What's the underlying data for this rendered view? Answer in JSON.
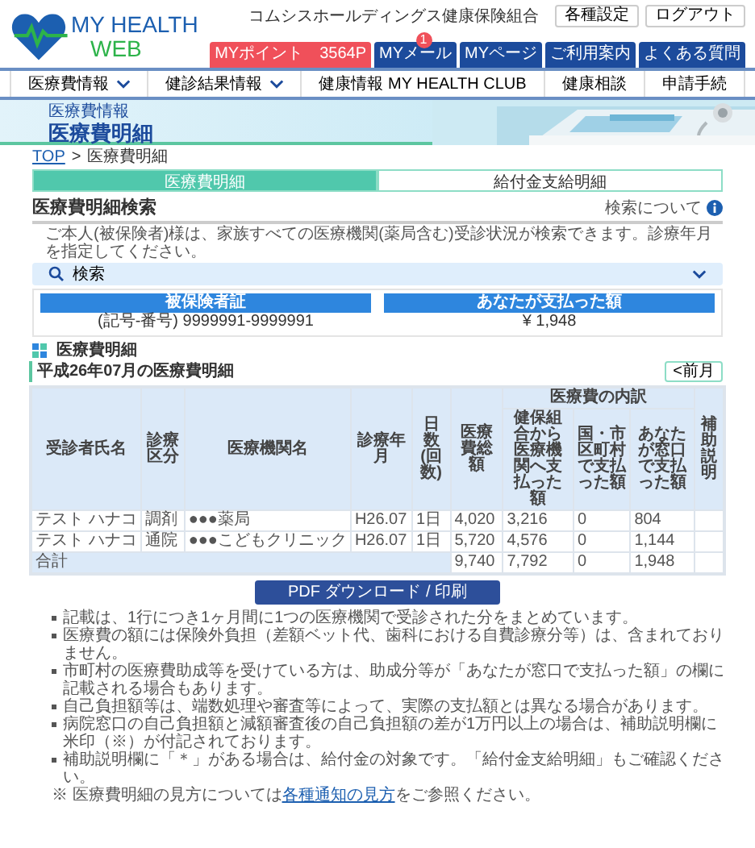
{
  "header": {
    "logo_title": "MY HEALTH",
    "logo_subtitle": "WEB",
    "org_name": "コムシスホールディングス健康保険組合",
    "buttons": [
      "各種設定",
      "ログアウト"
    ],
    "quick_links": [
      {
        "label": "MYポイント　3564P",
        "color": "#f0505a"
      },
      {
        "label": "MYメール",
        "color": "#1c4b9c",
        "badge": "1"
      },
      {
        "label": "MYページ",
        "color": "#1c4b9c"
      },
      {
        "label": "ご利用案内",
        "color": "#1c4b9c"
      },
      {
        "label": "よくある質問",
        "color": "#1c4b9c"
      }
    ]
  },
  "nav": [
    {
      "label": "医療費情報",
      "dropdown": true
    },
    {
      "label": "健診結果情報",
      "dropdown": true
    },
    {
      "label": "健康情報 MY HEALTH CLUB",
      "dropdown": false
    },
    {
      "label": "健康相談",
      "dropdown": false
    },
    {
      "label": "申請手続",
      "dropdown": false
    }
  ],
  "banner": {
    "category": "医療費情報",
    "title": "医療費明細"
  },
  "breadcrumb": {
    "items": [
      {
        "label": "TOP",
        "link": true
      },
      {
        "label": "医療費明細",
        "link": false
      }
    ],
    "separator": ">"
  },
  "tabs": [
    {
      "label": "医療費明細",
      "selected": true
    },
    {
      "label": "給付金支給明細",
      "selected": false
    }
  ],
  "search": {
    "title": "医療費明細検索",
    "help_link": "検索について",
    "description": "ご本人(被保険者)様は、家族すべての医療機関(薬局含む)受診状況が検索できます。診療年月を指定してください。",
    "label": "検索",
    "expanded": false
  },
  "summary": [
    {
      "heading": "被保険者証",
      "value": "(記号-番号) 9999991-9999991"
    },
    {
      "heading": "あなたが支払った額",
      "value": "¥ 1,948"
    }
  ],
  "detail": {
    "title": "医療費明細",
    "month_title": "平成26年07月の医療費明細",
    "prev_button": "<前月",
    "columns": [
      {
        "label": "受診者氏名"
      },
      {
        "label": "診療区分"
      },
      {
        "label": "医療機関名"
      },
      {
        "label": "診療年月"
      },
      {
        "label": "日数(回数)"
      },
      {
        "label": "医療費総額"
      },
      {
        "label": "医療費の内訳",
        "colspan": 3,
        "children": [
          {
            "label": "健保組合から医療機関へ支払った額"
          },
          {
            "label": "国・市区町村で支払った額"
          },
          {
            "label": "あなたが窓口で支払った額"
          }
        ]
      },
      {
        "label": "補助説明"
      }
    ],
    "rows": [
      {
        "cells": [
          "テスト ハナコ",
          "調剤",
          "●●●薬局",
          "H26.07",
          "1日",
          "4,020",
          "3,216",
          "0",
          "804"
        ]
      },
      {
        "cells": [
          "テスト ハナコ",
          "通院",
          "●●●こどもクリニック",
          "H26.07",
          "1日",
          "5,720",
          "4,576",
          "0",
          "1,144"
        ]
      }
    ],
    "total": {
      "label": "合計",
      "cells": [
        "9,740",
        "7,792",
        "0",
        "1,948"
      ]
    }
  },
  "pdf_button": "PDF ダウンロード / 印刷",
  "notes": [
    "記載は、1行につき1ヶ月間に1つの医療機関で受診された分をまとめています。",
    "医療費の額には保険外負担（差額ベット代、歯科における自費診療分等）は、含まれておりません。",
    "市町村の医療費助成等を受けている方は、助成分等が「あなたが窓口で支払った額」の欄に記載される場合もあります。",
    "自己負担額等は、端数処理や審査等によって、実際の支払額とは異なる場合があります。",
    "病院窓口の自己負担額と減額審査後の自己負担額の差が1万円以上の場合は、補助説明欄に米印（※）が付記されております。",
    "補助説明欄に「＊」がある場合は、給付金の対象です。「給付金支給明細」もご確認ください。"
  ],
  "footnote": {
    "before": "※ 医療費明細の見方については",
    "link": "各種通知の見方",
    "after": "をご参照ください。"
  }
}
